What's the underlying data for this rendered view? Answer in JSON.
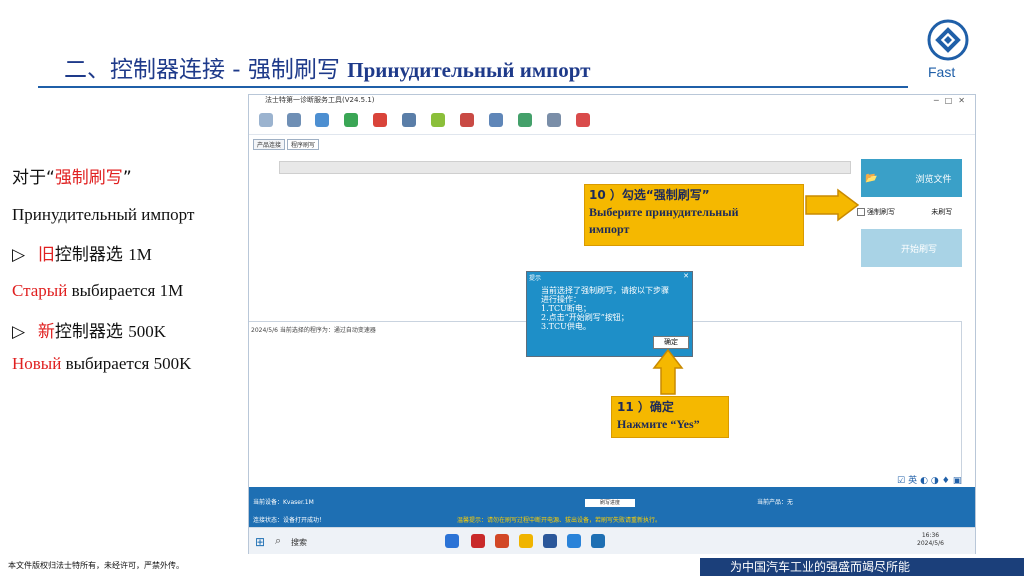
{
  "slide": {
    "title_cn": "二、控制器连接 - 强制刷写",
    "title_ru": "Принудительный импорт",
    "logo_word": "Fast",
    "footer_left": "本文件版权归法士特所有，未经许可，严禁外传。",
    "footer_right": "为中国汽车工业的强盛而竭尽所能",
    "brand_color": "#1f5fa8"
  },
  "left_text": {
    "line1_prefix": "对于“",
    "line1_red": "强制刷写",
    "line1_suffix": "”",
    "line2": "Принудительный импорт",
    "line3_bullet": "▷",
    "line3_red": "旧",
    "line3_rest": "控制器选 ",
    "line3_val": "1M",
    "line4_red": "Старый",
    "line4_rest": " выбирается ",
    "line4_val": "1M",
    "line5_bullet": "▷",
    "line5_red": "新",
    "line5_rest": "控制器选 ",
    "line5_val": "500K",
    "line6_red": "Новый",
    "line6_rest": " выбирается ",
    "line6_val": "500K"
  },
  "app": {
    "title": "法士特第一诊断服务工具(V24.5.1)",
    "tabs": [
      "产品连接",
      "程序刷写"
    ],
    "browse_label": "浏览文件",
    "checkbox_label": "强制刷写",
    "status_right": "未刷写",
    "start_label": "开始刷写",
    "log_text": "2024/5/6 当前选择的程序为：通过自动变速器",
    "status_device": "当前设备：Kvaser.1M",
    "status_conn": "连接状态：设备打开成功！",
    "status_product": "当前产品：无",
    "status_box": "刷写进度",
    "status_note": "温馨提示：请勿在刷写过程中断开电源、拔出设备，若刷写失败请重新执行。",
    "taskbar_search": "搜索",
    "clock_time": "16:36",
    "clock_date": "2024/5/6"
  },
  "dialog": {
    "title": "提示",
    "message": "当前选择了强制刷写，请按以下步骤\n进行操作：\n1.TCU断电；\n2.点击“开始刷写”按钮；\n3.TCU供电。",
    "ok_label": "确定"
  },
  "callouts": {
    "c10_line1": "10 ）勾选“强制刷写”",
    "c10_line2": "Выберите принудительный",
    "c10_line3": "импорт",
    "c11_line1": "11 ）确定",
    "c11_line2": "Нажмите “Yes”"
  }
}
